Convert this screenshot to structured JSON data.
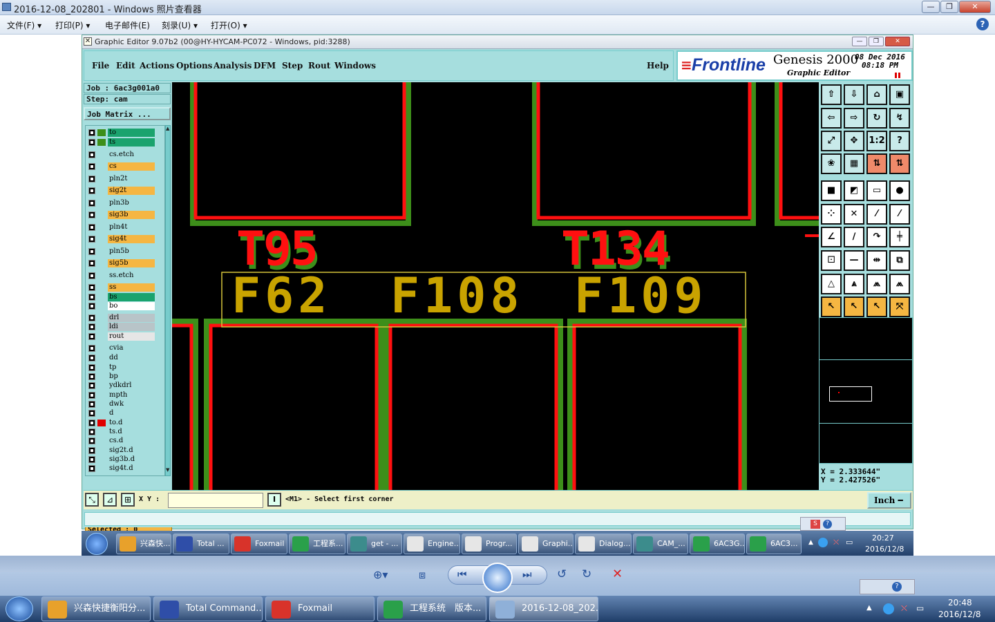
{
  "viewer": {
    "title": "2016-12-08_202801 - Windows 照片查看器",
    "menu": [
      "文件(F)",
      "打印(P)",
      "电子邮件(E)",
      "刻录(U)",
      "打开(O)"
    ],
    "help_icon": "help-circle-icon"
  },
  "app": {
    "title": "Graphic Editor 9.07b2 (00@HY-HYCAM-PC072 - Windows, pid:3288)",
    "menu": [
      "File",
      "Edit",
      "Actions",
      "Options",
      "Analysis",
      "DFM",
      "Step",
      "Rout",
      "Windows"
    ],
    "help": "Help",
    "brand": {
      "logo": "Frontline",
      "product": "Genesis 2000",
      "subtitle": "Graphic Editor",
      "date": "08 Dec 2016",
      "time": "08:18 PM"
    },
    "job": "Job : 6ac3g001a0",
    "step": "Step: cam",
    "job_matrix": "Job Matrix ...",
    "layers": [
      {
        "name": "to",
        "color": "#1aa36e",
        "sw": "#3d8f1a"
      },
      {
        "name": "ts",
        "color": "#1aa36e",
        "sw": "#3d8f1a"
      },
      {
        "name": "cs.etch",
        "color": "#a6dede",
        "sw": ""
      },
      {
        "name": "cs",
        "color": "#f5b642",
        "sw": ""
      },
      {
        "name": "pln2t",
        "color": "#a6dede",
        "sw": ""
      },
      {
        "name": "sig2t",
        "color": "#f5b642",
        "sw": ""
      },
      {
        "name": "pln3b",
        "color": "#a6dede",
        "sw": ""
      },
      {
        "name": "sig3b",
        "color": "#f5b642",
        "sw": ""
      },
      {
        "name": "pln4t",
        "color": "#a6dede",
        "sw": ""
      },
      {
        "name": "sig4t",
        "color": "#f5b642",
        "sw": ""
      },
      {
        "name": "pln5b",
        "color": "#a6dede",
        "sw": ""
      },
      {
        "name": "sig5b",
        "color": "#f5b642",
        "sw": ""
      },
      {
        "name": "ss.etch",
        "color": "#a6dede",
        "sw": ""
      },
      {
        "name": "ss",
        "color": "#f5b642",
        "sw": ""
      },
      {
        "name": "bs",
        "color": "#1aa36e",
        "sw": ""
      },
      {
        "name": "bo",
        "color": "#ffffff",
        "sw": ""
      },
      {
        "name": "drl",
        "color": "#b8c4c8",
        "sw": ""
      },
      {
        "name": "ldi",
        "color": "#b8c4c8",
        "sw": ""
      },
      {
        "name": "rout",
        "color": "#e6e6e6",
        "sw": ""
      },
      {
        "name": "cvia",
        "color": "#a6dede",
        "sw": ""
      },
      {
        "name": "dd",
        "color": "#a6dede",
        "sw": ""
      },
      {
        "name": "tp",
        "color": "#a6dede",
        "sw": ""
      },
      {
        "name": "bp",
        "color": "#a6dede",
        "sw": ""
      },
      {
        "name": "ydkdrl",
        "color": "#a6dede",
        "sw": ""
      },
      {
        "name": "mpth",
        "color": "#a6dede",
        "sw": ""
      },
      {
        "name": "dwk",
        "color": "#a6dede",
        "sw": ""
      },
      {
        "name": "d",
        "color": "#a6dede",
        "sw": ""
      },
      {
        "name": "to.d",
        "color": "#a6dede",
        "sw": "#e00000"
      },
      {
        "name": "ts.d",
        "color": "#a6dede",
        "sw": ""
      },
      {
        "name": "cs.d",
        "color": "#a6dede",
        "sw": ""
      },
      {
        "name": "sig2t.d",
        "color": "#a6dede",
        "sw": ""
      },
      {
        "name": "sig3b.d",
        "color": "#a6dede",
        "sw": ""
      },
      {
        "name": "sig4t.d",
        "color": "#a6dede",
        "sw": ""
      }
    ],
    "selected": "Selected : 0",
    "canvas": {
      "labels_red": [
        "T95",
        "T134"
      ],
      "labels_yellow": [
        "F62",
        "F108",
        "F109"
      ]
    },
    "coords": {
      "x": "X = 2.333644\"",
      "y": "Y = 2.427526\""
    },
    "cmd": {
      "xy_label": "X Y :",
      "prompt": "<M1> - Select first corner",
      "units": "Inch"
    }
  },
  "taskbar_inner": {
    "items": [
      "兴森快...",
      "Total ...",
      "Foxmail",
      "工程系...",
      "get - ...",
      "Engine...",
      "Progr...",
      "Graphi...",
      "Dialog...",
      "CAM_...",
      "6AC3G...",
      "6AC3..."
    ],
    "time": "20:27",
    "date": "2016/12/8"
  },
  "taskbar_outer": {
    "items": [
      "兴森快捷衡阳分...",
      "Total Command...",
      "Foxmail",
      "工程系统　版本...",
      "2016-12-08_202..."
    ],
    "time": "20:48",
    "date": "2016/12/8"
  }
}
